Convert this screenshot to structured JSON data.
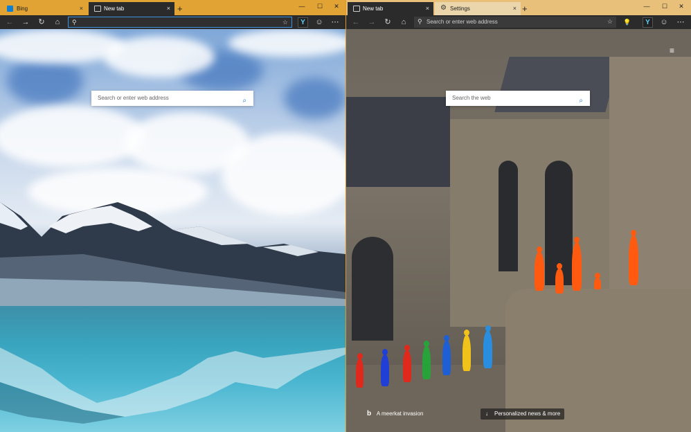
{
  "left_window": {
    "tabs": [
      {
        "label": "Bing",
        "close": "×",
        "active": false
      },
      {
        "label": "New tab",
        "close": "×",
        "active": true
      }
    ],
    "new_tab": "+",
    "window_controls": {
      "minimize": "—",
      "maximize": "☐",
      "close": "✕"
    },
    "toolbar": {
      "back": "←",
      "forward": "→",
      "refresh": "↻",
      "home": "⌂",
      "address_value": "",
      "favorite": "☆",
      "extension": "Y",
      "feedback": "☺",
      "more": "⋯"
    },
    "page": {
      "search_placeholder": "Search or enter web address",
      "search_icon": "⌕"
    }
  },
  "right_window": {
    "tabs": [
      {
        "label": "New tab",
        "close": "×",
        "active": true
      },
      {
        "label": "Settings",
        "close": "×",
        "active": false
      }
    ],
    "new_tab": "+",
    "window_controls": {
      "minimize": "—",
      "maximize": "☐",
      "close": "✕"
    },
    "toolbar": {
      "back": "←",
      "forward": "→",
      "refresh": "↻",
      "home": "⌂",
      "address_placeholder": "Search or enter web address",
      "favorite": "☆",
      "lightbulb": "💡",
      "extension": "Y",
      "feedback": "☺",
      "more": "⋯"
    },
    "page": {
      "search_placeholder": "Search the web",
      "search_icon": "⌕",
      "menu_icon": "≡",
      "image_caption": "A meerkat invasion",
      "news_label": "Personalized news & more",
      "news_arrow": "↓",
      "bing_logo": "b"
    }
  },
  "colors": {
    "left_tabstrip": "#e1a334",
    "right_tabstrip": "#e8c07a",
    "toolbar": "#2b2b2b",
    "address_focus": "#3c93e0",
    "search_icon": "#1f7acc",
    "meerkats": [
      "#e0291d",
      "#1f3fd6",
      "#e0291d",
      "#28a33a",
      "#1f5fd6",
      "#f1c21a",
      "#2a8ee0",
      "#ff5a10"
    ]
  }
}
